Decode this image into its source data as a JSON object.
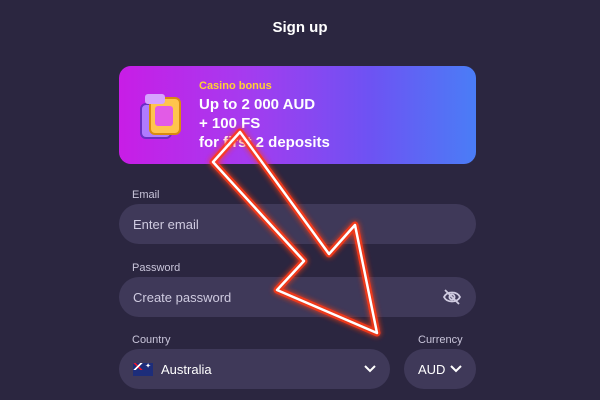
{
  "header": {
    "title": "Sign up"
  },
  "bonus": {
    "label": "Casino bonus",
    "line1": "Up to 2 000 AUD",
    "line2": "+ 100 FS",
    "line3": "for first 2 deposits",
    "icon": "gift-box-icon"
  },
  "form": {
    "email": {
      "label": "Email",
      "placeholder": "Enter email"
    },
    "password": {
      "label": "Password",
      "placeholder": "Create password",
      "icon": "eye-off-icon"
    },
    "country": {
      "label": "Country",
      "value": "Australia",
      "icon": "australia-flag-icon"
    },
    "currency": {
      "label": "Currency",
      "value": "AUD"
    }
  },
  "colors": {
    "background": "#2b2640",
    "input_bg": "#3f3959",
    "bonus_label": "#ffd233",
    "arrow": "#ff3a14"
  }
}
